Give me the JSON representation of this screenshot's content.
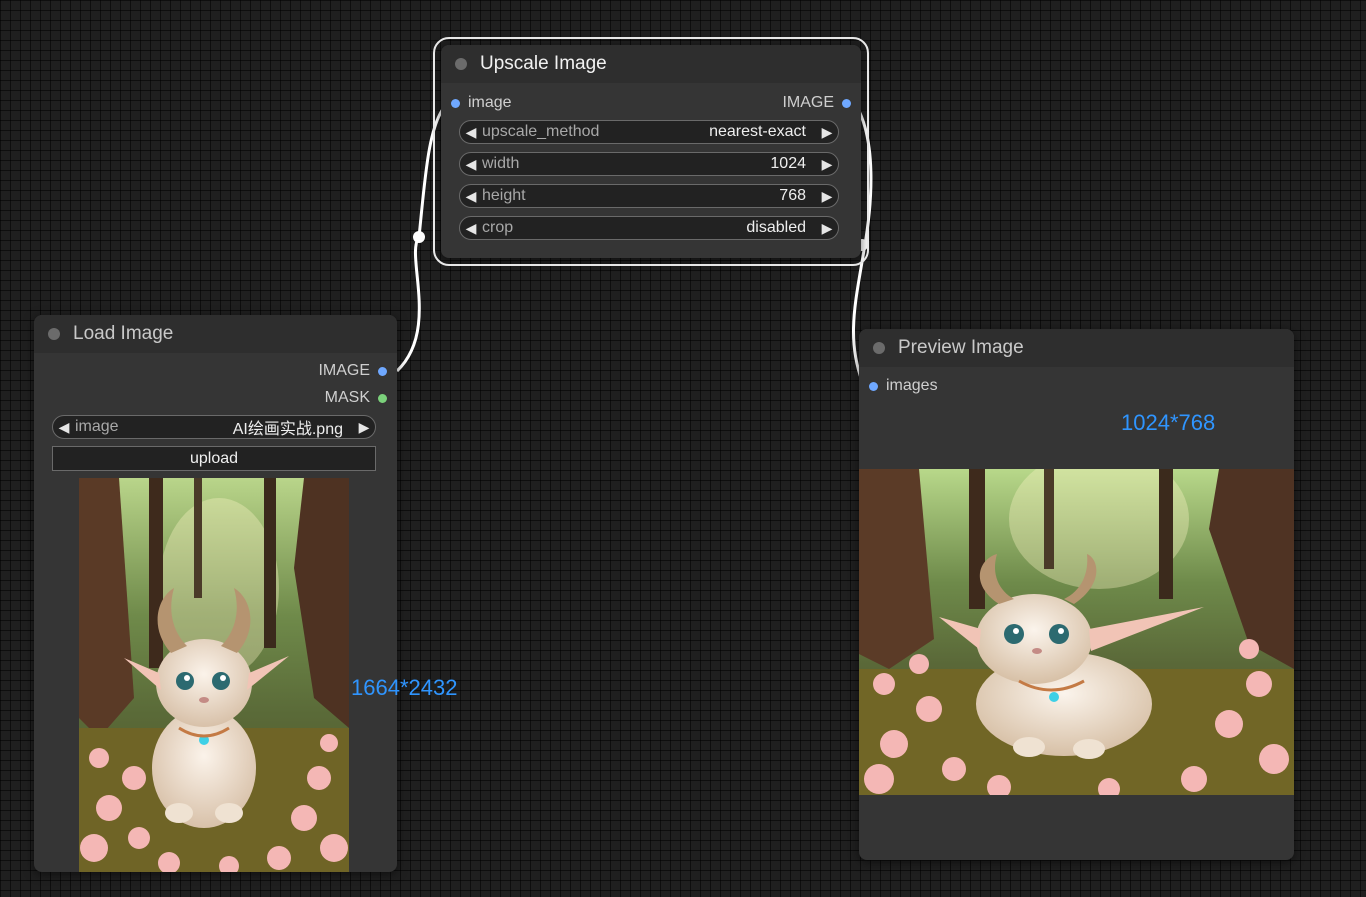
{
  "nodes": {
    "upscale": {
      "title": "Upscale Image",
      "input": "image",
      "output": "IMAGE",
      "widgets": [
        {
          "name": "upscale_method",
          "value": "nearest-exact"
        },
        {
          "name": "width",
          "value": "1024"
        },
        {
          "name": "height",
          "value": "768"
        },
        {
          "name": "crop",
          "value": "disabled"
        }
      ]
    },
    "load": {
      "title": "Load Image",
      "outputs": [
        "IMAGE",
        "MASK"
      ],
      "widget": {
        "name": "image",
        "value": "AI绘画实战.png"
      },
      "button": "upload",
      "size": "1664*2432"
    },
    "preview": {
      "title": "Preview Image",
      "input": "images",
      "size": "1024*768"
    }
  },
  "icons": {
    "left_arrow": "◀",
    "right_arrow": "▶"
  },
  "colors": {
    "canvas": "#1f1f1f",
    "node_body": "#353535",
    "node_header": "#2e2e2e",
    "image_slot": "#6fa8ff",
    "mask_slot": "#7bd17b",
    "size_label": "#2f95ff",
    "link": "#ffffff"
  }
}
